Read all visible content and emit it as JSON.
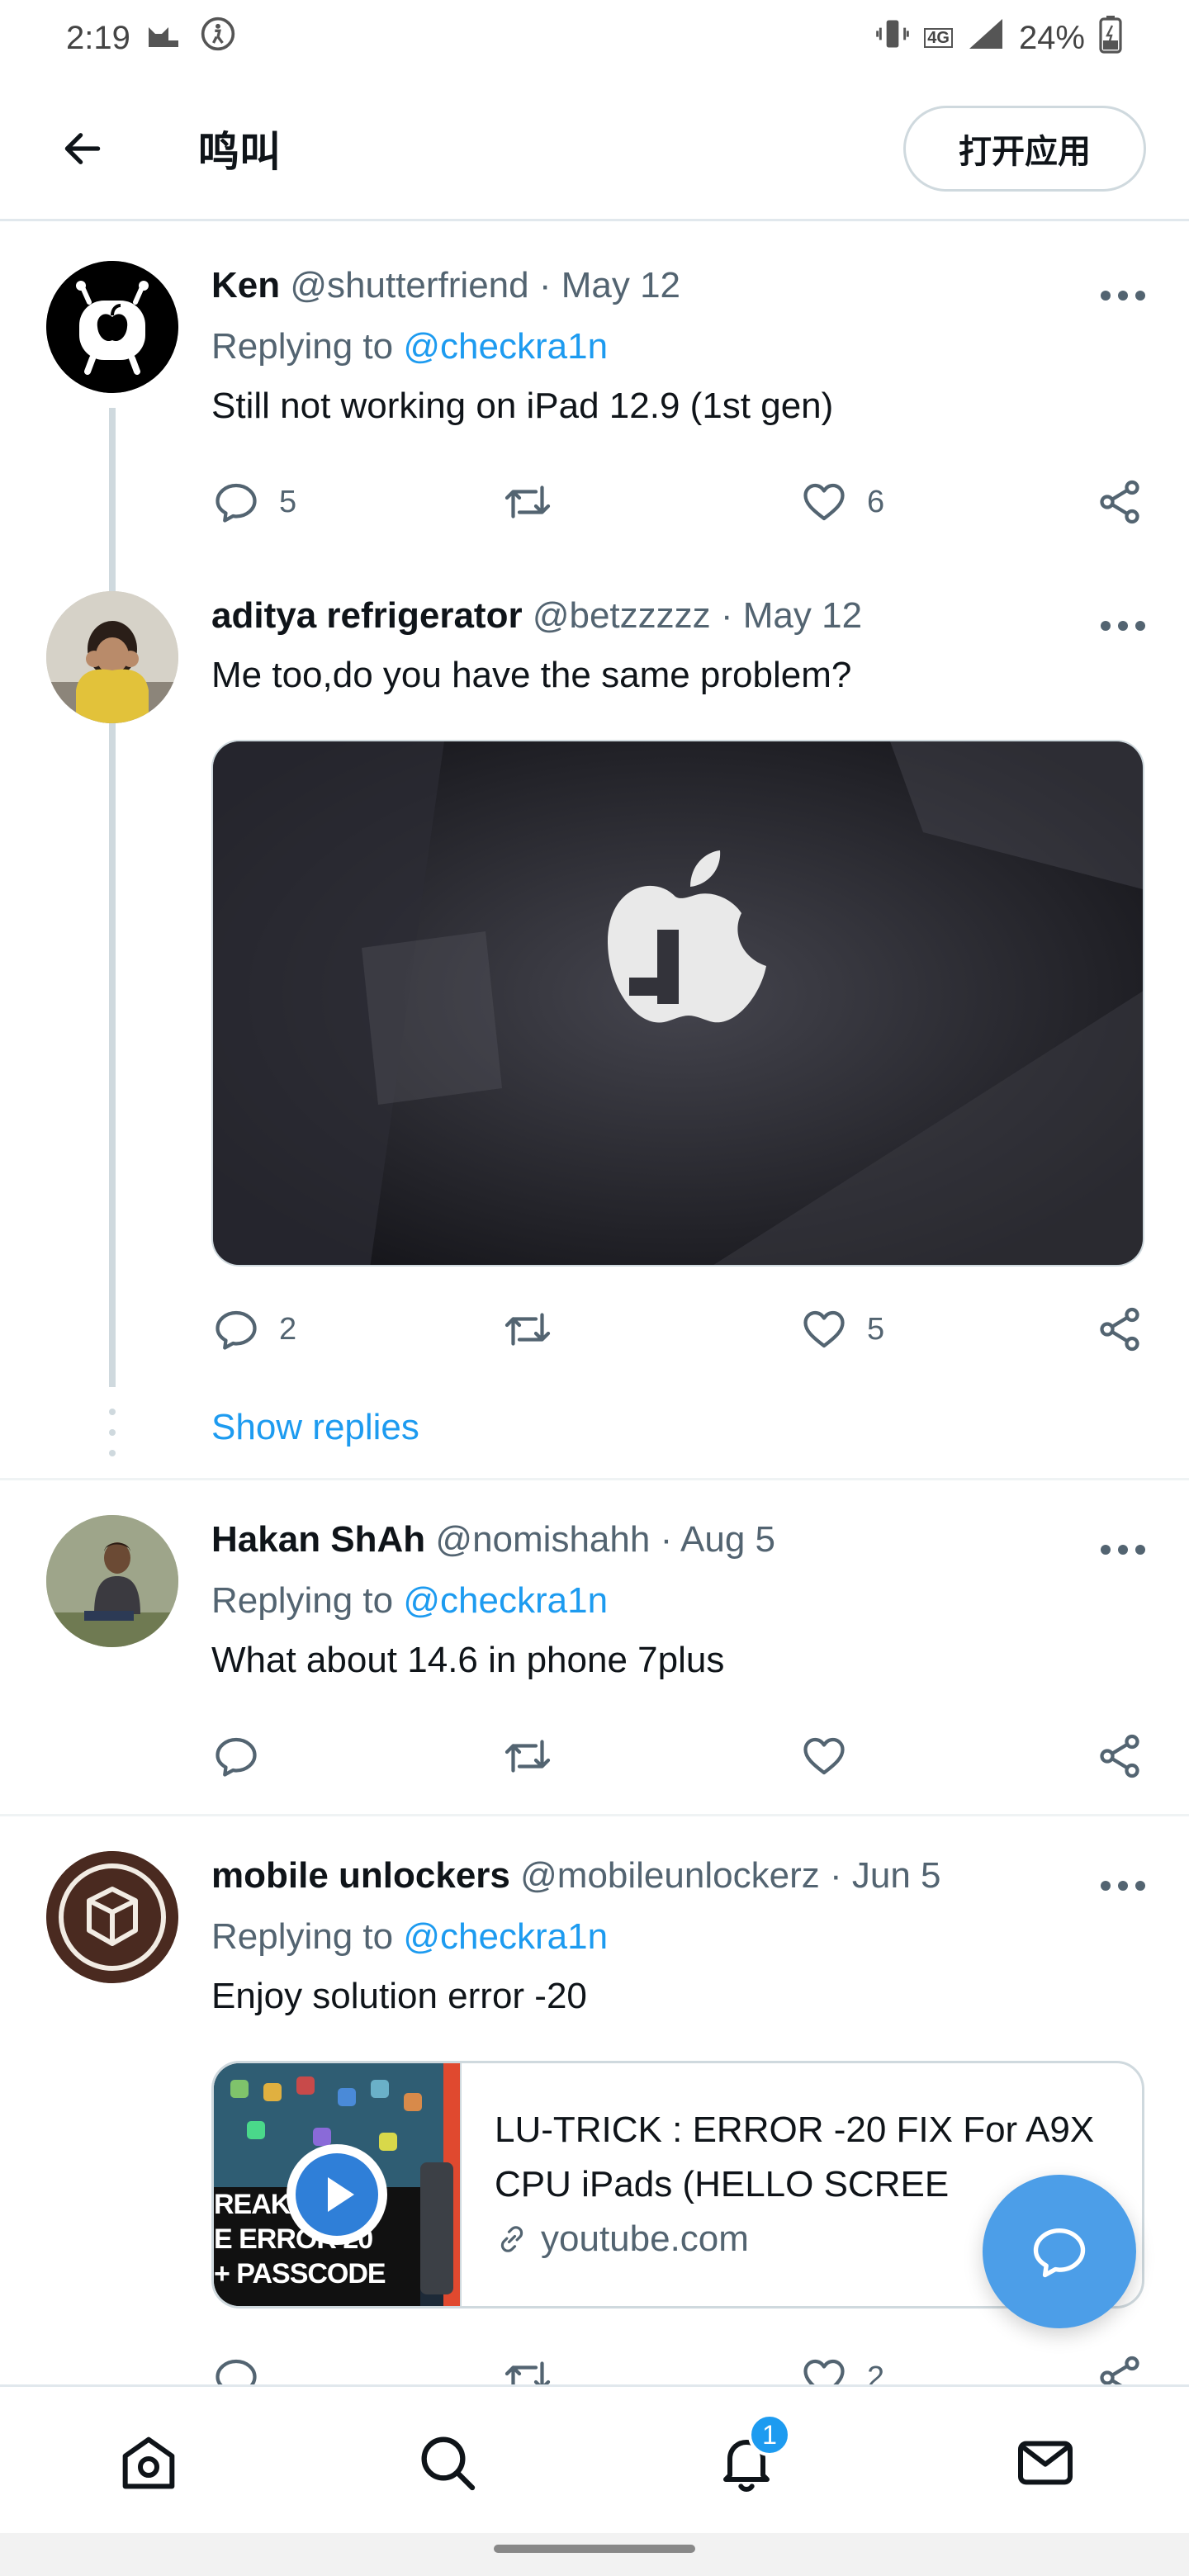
{
  "status_bar": {
    "time": "2:19",
    "network": "4G",
    "battery": "24%"
  },
  "header": {
    "title": "鸣叫",
    "open_app_label": "打开应用"
  },
  "tweets": [
    {
      "name": "Ken",
      "handle": "@shutterfriend",
      "date": "May 12",
      "replying_prefix": "Replying to",
      "replying_to": "@checkra1n",
      "text": "Still not working on iPad 12.9 (1st gen)",
      "reply_count": "5",
      "like_count": "6"
    },
    {
      "name": "aditya refrigerator",
      "handle": "@betzzzzz",
      "date": "May 12",
      "text": "Me too,do you have the same problem?",
      "reply_count": "2",
      "like_count": "5"
    },
    {
      "name": "Hakan ShAh",
      "handle": "@nomishahh",
      "date": "Aug 5",
      "replying_prefix": "Replying to",
      "replying_to": "@checkra1n",
      "text": "What about 14.6 in phone 7plus"
    },
    {
      "name": "mobile unlockers",
      "handle": "@mobileunlockerz",
      "date": "Jun 5",
      "replying_prefix": "Replying to",
      "replying_to": "@checkra1n",
      "text": "Enjoy solution error -20",
      "like_count": "2",
      "card": {
        "title": "LU-TRICK : ERROR -20 FIX For A9X CPU iPads (HELLO SCREE",
        "domain": "youtube.com",
        "thumb_lines": [
          "REAK",
          "E ERROR 20",
          "+ PASSCODE"
        ]
      }
    }
  ],
  "show_replies_label": "Show replies",
  "nav": {
    "notifications_badge": "1"
  },
  "colors": {
    "accent": "#1d9bf0",
    "fab": "#4c9ee8",
    "secondary_text": "#536471"
  }
}
